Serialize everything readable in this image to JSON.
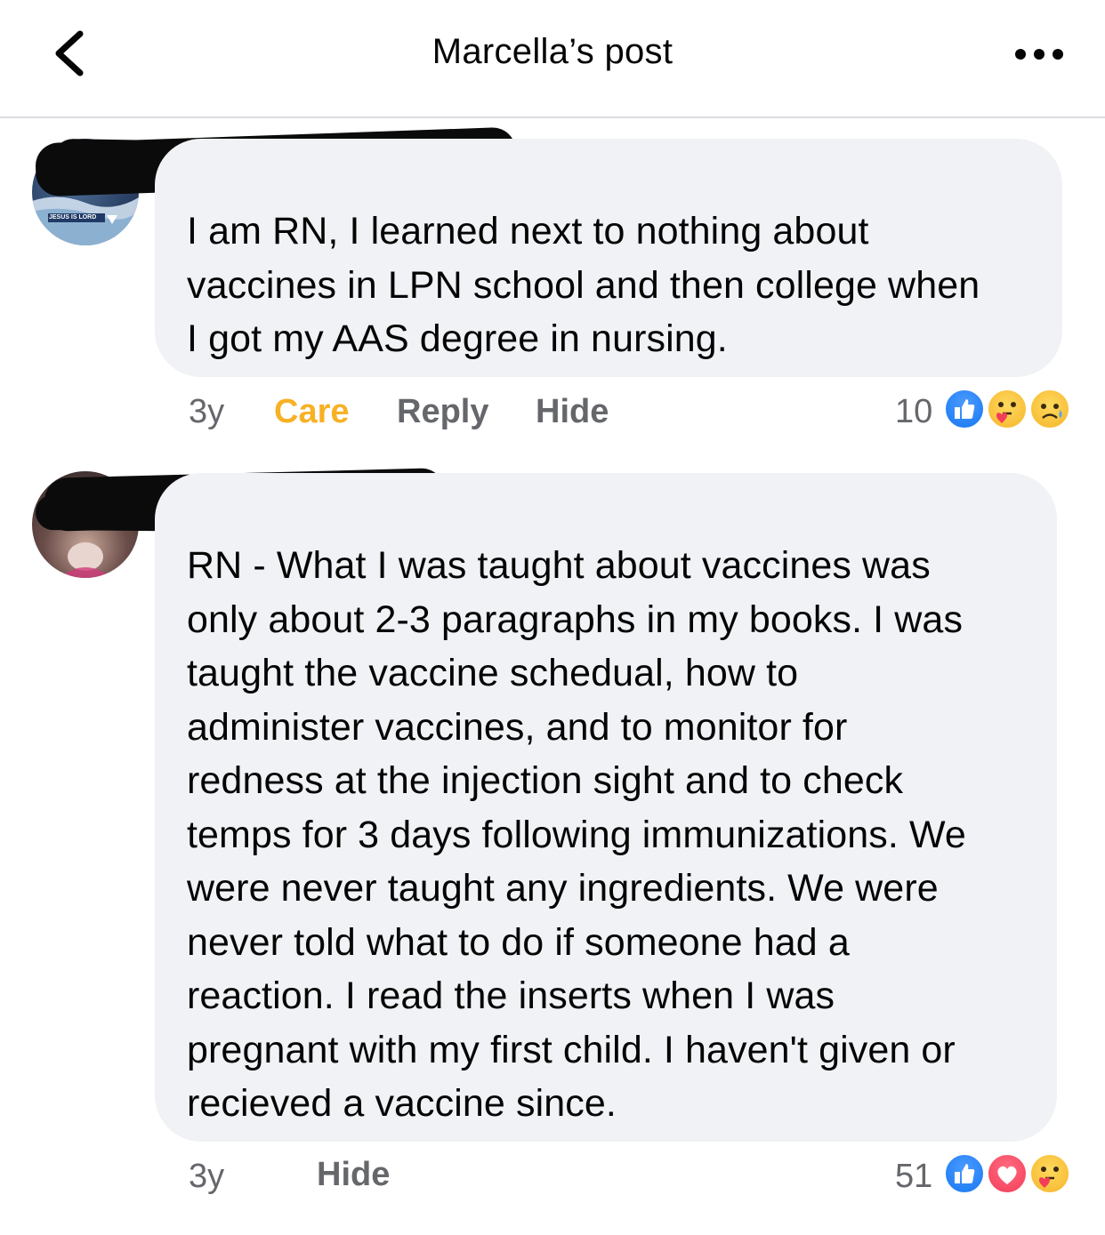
{
  "header": {
    "title": "Marcella’s post",
    "back_icon": "chevron-left-icon",
    "more_icon": "more-dots-icon"
  },
  "comments": [
    {
      "avatar_text": "JESUS IS LORD",
      "text": "I am RN, I learned next to nothing about\nvaccines in LPN school and then college when\nI got my AAS degree in nursing.",
      "time": "3y",
      "care_label": "Care",
      "reply_label": "Reply",
      "hide_label": "Hide",
      "reaction_count": "10",
      "reactions": [
        "like",
        "care",
        "sad"
      ]
    },
    {
      "text": "RN - What I was taught about vaccines was\nonly about 2-3 paragraphs in my books. I was\ntaught the vaccine schedual, how to\nadminister vaccines, and to monitor for\nredness at the injection sight and to check\ntemps for 3 days following immunizations. We\nwere never taught any ingredients. We were\nnever told what to do if someone had a\nreaction. I read the inserts when I was\npregnant with my first child. I haven't given or\nrecieved a vaccine since.",
      "time": "3y",
      "hide_label": "Hide",
      "reaction_count": "51",
      "reactions": [
        "like",
        "love",
        "care"
      ]
    }
  ],
  "colors": {
    "care_accent": "#f7b125",
    "like_blue": "#1877f2",
    "love_red": "#f33e58",
    "bubble_bg": "#f0f2f5",
    "meta_gray": "#65676b"
  }
}
